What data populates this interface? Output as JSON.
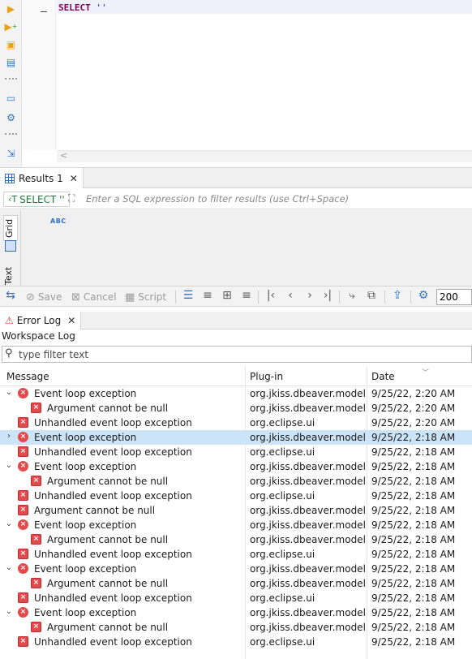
{
  "editor": {
    "sql_keyword": "SELECT",
    "sql_string": " ''",
    "scroll_left": "<"
  },
  "results": {
    "tab_label": "Results 1",
    "query_label": "SELECT ''",
    "filter_placeholder": "Enter a SQL expression to filter results (use Ctrl+Space)",
    "column_type_badge": "ABC",
    "side_tabs": {
      "grid": "Grid",
      "text": "Text"
    }
  },
  "results_toolbar": {
    "save": "Save",
    "cancel": "Cancel",
    "script": "Script",
    "fetch_size": "200"
  },
  "error_log": {
    "tab_label": "Error Log",
    "title": "Workspace Log",
    "filter_placeholder": "type filter text",
    "columns": {
      "message": "Message",
      "plugin": "Plug-in",
      "date": "Date"
    },
    "rows": [
      {
        "twisty": "⌄",
        "level": 0,
        "icon": "error-circle",
        "message": "Event loop exception",
        "plugin": "org.jkiss.dbeaver.model",
        "date": "9/25/22, 2:20 AM",
        "selected": false
      },
      {
        "twisty": "",
        "level": 1,
        "icon": "error-badge",
        "message": "Argument cannot be null",
        "plugin": "org.jkiss.dbeaver.model",
        "date": "9/25/22, 2:20 AM",
        "selected": false
      },
      {
        "twisty": "",
        "level": 0,
        "icon": "error-badge",
        "message": "Unhandled event loop exception",
        "plugin": "org.eclipse.ui",
        "date": "9/25/22, 2:20 AM",
        "selected": false
      },
      {
        "twisty": "›",
        "level": 0,
        "icon": "error-circle",
        "message": "Event loop exception",
        "plugin": "org.jkiss.dbeaver.model",
        "date": "9/25/22, 2:18 AM",
        "selected": true
      },
      {
        "twisty": "",
        "level": 0,
        "icon": "error-badge",
        "message": "Unhandled event loop exception",
        "plugin": "org.eclipse.ui",
        "date": "9/25/22, 2:18 AM",
        "selected": false
      },
      {
        "twisty": "⌄",
        "level": 0,
        "icon": "error-circle",
        "message": "Event loop exception",
        "plugin": "org.jkiss.dbeaver.model",
        "date": "9/25/22, 2:18 AM",
        "selected": false
      },
      {
        "twisty": "",
        "level": 1,
        "icon": "error-badge",
        "message": "Argument cannot be null",
        "plugin": "org.jkiss.dbeaver.model",
        "date": "9/25/22, 2:18 AM",
        "selected": false
      },
      {
        "twisty": "",
        "level": 0,
        "icon": "error-badge",
        "message": "Unhandled event loop exception",
        "plugin": "org.eclipse.ui",
        "date": "9/25/22, 2:18 AM",
        "selected": false
      },
      {
        "twisty": "",
        "level": 0,
        "icon": "error-badge",
        "message": "Argument cannot be null",
        "plugin": "org.jkiss.dbeaver.model",
        "date": "9/25/22, 2:18 AM",
        "selected": false
      },
      {
        "twisty": "⌄",
        "level": 0,
        "icon": "error-circle",
        "message": "Event loop exception",
        "plugin": "org.jkiss.dbeaver.model",
        "date": "9/25/22, 2:18 AM",
        "selected": false
      },
      {
        "twisty": "",
        "level": 1,
        "icon": "error-badge",
        "message": "Argument cannot be null",
        "plugin": "org.jkiss.dbeaver.model",
        "date": "9/25/22, 2:18 AM",
        "selected": false
      },
      {
        "twisty": "",
        "level": 0,
        "icon": "error-badge",
        "message": "Unhandled event loop exception",
        "plugin": "org.eclipse.ui",
        "date": "9/25/22, 2:18 AM",
        "selected": false
      },
      {
        "twisty": "⌄",
        "level": 0,
        "icon": "error-circle",
        "message": "Event loop exception",
        "plugin": "org.jkiss.dbeaver.model",
        "date": "9/25/22, 2:18 AM",
        "selected": false
      },
      {
        "twisty": "",
        "level": 1,
        "icon": "error-badge",
        "message": "Argument cannot be null",
        "plugin": "org.jkiss.dbeaver.model",
        "date": "9/25/22, 2:18 AM",
        "selected": false
      },
      {
        "twisty": "",
        "level": 0,
        "icon": "error-badge",
        "message": "Unhandled event loop exception",
        "plugin": "org.eclipse.ui",
        "date": "9/25/22, 2:18 AM",
        "selected": false
      },
      {
        "twisty": "⌄",
        "level": 0,
        "icon": "error-circle",
        "message": "Event loop exception",
        "plugin": "org.jkiss.dbeaver.model",
        "date": "9/25/22, 2:18 AM",
        "selected": false
      },
      {
        "twisty": "",
        "level": 1,
        "icon": "error-badge",
        "message": "Argument cannot be null",
        "plugin": "org.jkiss.dbeaver.model",
        "date": "9/25/22, 2:18 AM",
        "selected": false
      },
      {
        "twisty": "",
        "level": 0,
        "icon": "error-badge",
        "message": "Unhandled event loop exception",
        "plugin": "org.eclipse.ui",
        "date": "9/25/22, 2:18 AM",
        "selected": false
      }
    ]
  },
  "colors": {
    "accent": "#2f74c5",
    "selected_row": "#cce4f7",
    "error": "#e24b4b",
    "sql_keyword": "#7f0055"
  }
}
